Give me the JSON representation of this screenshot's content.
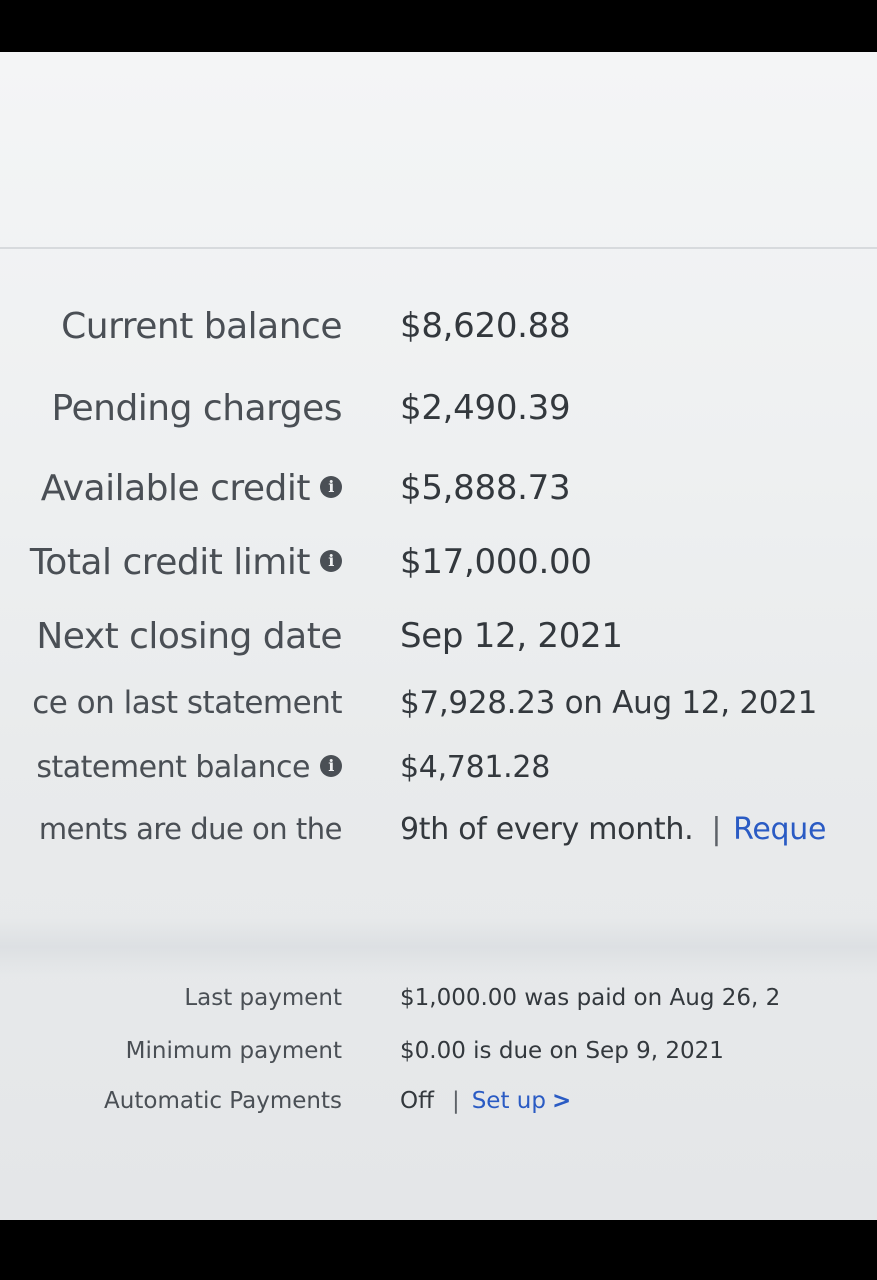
{
  "account_summary": {
    "current_balance_label": "Current balance",
    "current_balance_value": "$8,620.88",
    "pending_charges_label": "Pending charges",
    "pending_charges_value": "$2,490.39",
    "available_credit_label": "Available credit",
    "available_credit_value": "$5,888.73",
    "total_credit_limit_label": "Total credit limit",
    "total_credit_limit_value": "$17,000.00",
    "next_closing_date_label": "Next closing date",
    "next_closing_date_value": "Sep 12, 2021",
    "last_statement_label": "ce on last statement",
    "last_statement_value": "$7,928.23 on Aug 12, 2021",
    "statement_balance_label": "statement balance",
    "statement_balance_value": "$4,781.28",
    "payments_due_label": "ments are due on the",
    "payments_due_value": "9th of every month.",
    "request_link": "Reque"
  },
  "payments": {
    "last_payment_label": "Last payment",
    "last_payment_value": "$1,000.00 was paid on Aug 26, 2",
    "minimum_payment_label": "Minimum payment",
    "minimum_payment_value": "$0.00 is due on Sep 9, 2021",
    "automatic_payments_label": "Automatic Payments",
    "automatic_payments_value": "Off",
    "setup_link": "Set up"
  },
  "icons": {
    "info": "info-icon",
    "chevron": "chevron-right-icon"
  },
  "colors": {
    "link": "#2a5bc4",
    "text": "#4a4f55"
  }
}
